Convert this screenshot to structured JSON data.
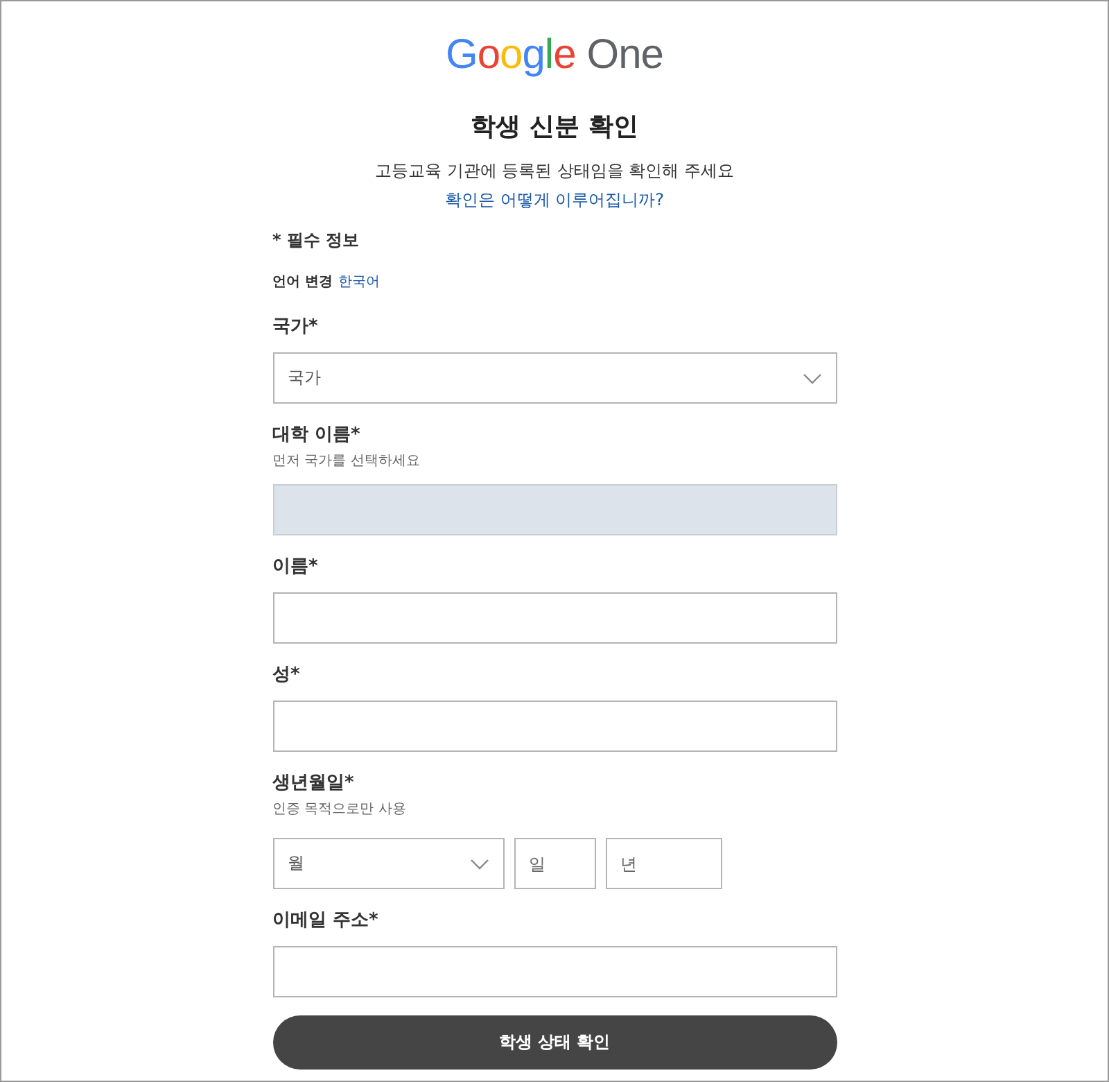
{
  "logo": {
    "brand": "Google",
    "product": "One"
  },
  "title": "학생 신분 확인",
  "subtitle": "고등교육 기관에 등록된 상태임을 확인해 주세요",
  "help_link": "확인은 어떻게 이루어집니까?",
  "required_note": "* 필수 정보",
  "language": {
    "label": "언어 변경",
    "value": "한국어"
  },
  "fields": [
    {
      "kind": "select",
      "label": "국가*",
      "placeholder": "국가"
    },
    {
      "kind": "text",
      "label": "대학 이름*",
      "hint": "먼저 국가를 선택하세요",
      "disabled": true
    },
    {
      "kind": "text",
      "label": "이름*",
      "disabled": false
    },
    {
      "kind": "text",
      "label": "성*",
      "disabled": false
    },
    {
      "kind": "date",
      "label": "생년월일*",
      "hint": "인증 목적으로만 사용",
      "parts": [
        {
          "kind": "select",
          "placeholder": "월"
        },
        {
          "kind": "text",
          "placeholder": "일"
        },
        {
          "kind": "text",
          "placeholder": "년"
        }
      ]
    },
    {
      "kind": "text",
      "label": "이메일 주소*",
      "disabled": false
    }
  ],
  "submit": "학생 상태 확인"
}
